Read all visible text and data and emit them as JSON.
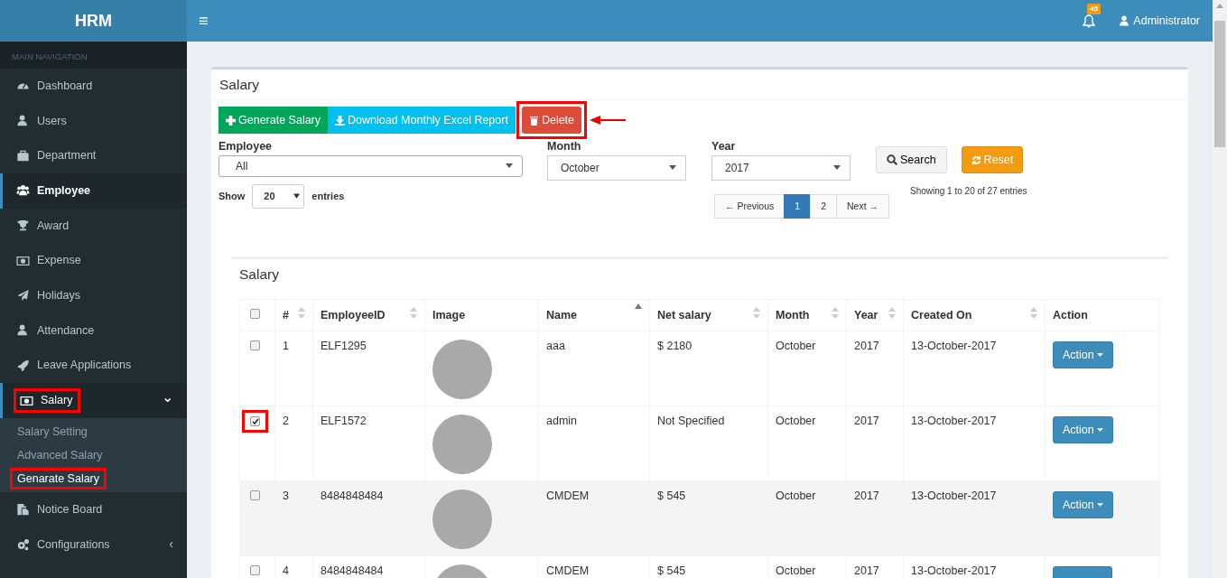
{
  "brand": "HRM",
  "topbar": {
    "menu_toggle": "≡",
    "notifications": "45",
    "user": "Administrator"
  },
  "sidebar": {
    "header": "MAIN NAVIGATION",
    "items": [
      {
        "label": "Dashboard",
        "selected": false,
        "highlighted": false
      },
      {
        "label": "Users",
        "selected": false,
        "highlighted": false
      },
      {
        "label": "Department",
        "selected": false,
        "highlighted": false
      },
      {
        "label": "Employee",
        "selected": true,
        "highlighted": false
      },
      {
        "label": "Award",
        "selected": false,
        "highlighted": false
      },
      {
        "label": "Expense",
        "selected": false,
        "highlighted": false
      },
      {
        "label": "Holidays",
        "selected": false,
        "highlighted": false
      },
      {
        "label": "Attendance",
        "selected": false,
        "highlighted": false
      },
      {
        "label": "Leave Applications",
        "selected": false,
        "highlighted": false
      },
      {
        "label": "Salary",
        "selected": true,
        "expanded": true,
        "highlighted": true,
        "caret": "⌄",
        "children": [
          {
            "label": "Salary Setting",
            "selected": false,
            "highlighted": false
          },
          {
            "label": "Advanced Salary",
            "selected": false,
            "highlighted": false
          },
          {
            "label": "Genarate Salary",
            "selected": true,
            "highlighted": true
          }
        ]
      },
      {
        "label": "Notice Board",
        "selected": false,
        "highlighted": false
      },
      {
        "label": "Configurations",
        "selected": false,
        "expanded": false,
        "highlighted": false,
        "caret": "‹"
      }
    ]
  },
  "panel": {
    "title": "Salary",
    "buttons": [
      {
        "kind": "success",
        "label": "Generate Salary",
        "highlighted": false
      },
      {
        "kind": "info",
        "label": "Download Monthly Excel Report",
        "highlighted": false
      },
      {
        "kind": "danger",
        "label": "Delete",
        "highlighted": true
      }
    ],
    "filters": [
      {
        "label": "Employee",
        "value": "All"
      },
      {
        "label": "Month",
        "value": "October"
      },
      {
        "label": "Year",
        "value": "2017"
      }
    ],
    "search_button": "Search",
    "reset_button": "Reset",
    "length": {
      "before": "Show",
      "value": "20",
      "after": "entries"
    },
    "pagination": [
      {
        "label": "← Previous",
        "selected": false
      },
      {
        "label": "1",
        "selected": true
      },
      {
        "label": "2",
        "selected": false
      },
      {
        "label": "Next →",
        "selected": false
      }
    ],
    "info": "Showing 1 to 20 of 27 entries"
  },
  "table": {
    "title": "Salary",
    "header_checked": false,
    "columns": [
      {
        "label": "#",
        "sortable": true,
        "sorted_ascending": false
      },
      {
        "label": "EmployeeID",
        "sortable": true,
        "sorted_ascending": false
      },
      {
        "label": "Image",
        "sortable": false
      },
      {
        "label": "Name",
        "sortable": true,
        "sorted_ascending": true
      },
      {
        "label": "Net salary",
        "sortable": true,
        "sorted_ascending": false
      },
      {
        "label": "Month",
        "sortable": true,
        "sorted_ascending": false
      },
      {
        "label": "Year",
        "sortable": true,
        "sorted_ascending": false
      },
      {
        "label": "Created On",
        "sortable": true,
        "sorted_ascending": false
      },
      {
        "label": "Action",
        "sortable": false
      }
    ],
    "rows": [
      {
        "checked": false,
        "highlighted": false,
        "no": "1",
        "employee_id": "ELF1295",
        "name": "aaa",
        "currency": "$",
        "net_salary": "2180",
        "month": "October",
        "year": "2017",
        "created_on": "13-October-2017",
        "action": "Action"
      },
      {
        "checked": true,
        "highlighted": true,
        "no": "2",
        "employee_id": "ELF1572",
        "name": "admin",
        "net_salary": "Not Specified",
        "month": "October",
        "year": "2017",
        "created_on": "13-October-2017",
        "action": "Action"
      },
      {
        "checked": false,
        "highlighted": false,
        "no": "3",
        "employee_id": "8484848484",
        "name": "CMDEM",
        "currency": "$",
        "net_salary": "545",
        "month": "October",
        "year": "2017",
        "created_on": "13-October-2017",
        "action": "Action"
      },
      {
        "checked": false,
        "highlighted": false,
        "no": "4",
        "employee_id": "8484848484",
        "name": "CMDEM",
        "currency": "$",
        "net_salary": "545",
        "month": "October",
        "year": "2017",
        "created_on": "13-October-2017"
      }
    ]
  }
}
